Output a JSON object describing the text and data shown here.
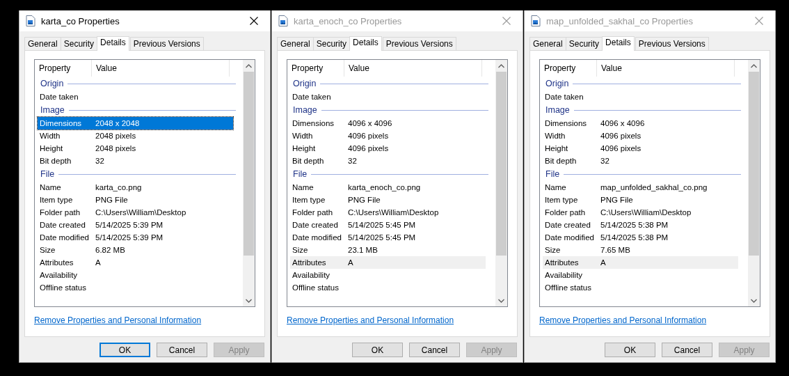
{
  "windows": [
    {
      "title": "karta_co Properties",
      "active": true,
      "tabs": [
        {
          "label": "General",
          "selected": false
        },
        {
          "label": "Security",
          "selected": false
        },
        {
          "label": "Details",
          "selected": true
        },
        {
          "label": "Previous Versions",
          "selected": false
        }
      ],
      "columns": [
        "Property",
        "Value"
      ],
      "groups": [
        {
          "name": "Origin",
          "rows": [
            {
              "property": "Date taken",
              "value": "",
              "selected": false
            }
          ]
        },
        {
          "name": "Image",
          "rows": [
            {
              "property": "Dimensions",
              "value": "2048 x 2048",
              "selected": true
            },
            {
              "property": "Width",
              "value": "2048 pixels",
              "selected": false
            },
            {
              "property": "Height",
              "value": "2048 pixels",
              "selected": false
            },
            {
              "property": "Bit depth",
              "value": "32",
              "selected": false
            }
          ]
        },
        {
          "name": "File",
          "rows": [
            {
              "property": "Name",
              "value": "karta_co.png",
              "selected": false
            },
            {
              "property": "Item type",
              "value": "PNG File",
              "selected": false
            },
            {
              "property": "Folder path",
              "value": "C:\\Users\\William\\Desktop",
              "selected": false
            },
            {
              "property": "Date created",
              "value": "5/14/2025 5:39 PM",
              "selected": false
            },
            {
              "property": "Date modified",
              "value": "5/14/2025 5:39 PM",
              "selected": false
            },
            {
              "property": "Size",
              "value": "6.82 MB",
              "selected": false
            },
            {
              "property": "Attributes",
              "value": "A",
              "selected": false
            },
            {
              "property": "Availability",
              "value": "",
              "selected": false
            },
            {
              "property": "Offline status",
              "value": "",
              "selected": false
            }
          ]
        }
      ],
      "link": "Remove Properties and Personal Information",
      "buttons": [
        {
          "label": "OK",
          "disabled": false
        },
        {
          "label": "Cancel",
          "disabled": false
        },
        {
          "label": "Apply",
          "disabled": true
        }
      ]
    },
    {
      "title": "karta_enoch_co Properties",
      "active": false,
      "tabs": [
        {
          "label": "General",
          "selected": false
        },
        {
          "label": "Security",
          "selected": false
        },
        {
          "label": "Details",
          "selected": true
        },
        {
          "label": "Previous Versions",
          "selected": false
        }
      ],
      "columns": [
        "Property",
        "Value"
      ],
      "groups": [
        {
          "name": "Origin",
          "rows": [
            {
              "property": "Date taken",
              "value": "",
              "selected": false
            }
          ]
        },
        {
          "name": "Image",
          "rows": [
            {
              "property": "Dimensions",
              "value": "4096 x 4096",
              "selected": false
            },
            {
              "property": "Width",
              "value": "4096 pixels",
              "selected": false
            },
            {
              "property": "Height",
              "value": "4096 pixels",
              "selected": false
            },
            {
              "property": "Bit depth",
              "value": "32",
              "selected": false
            }
          ]
        },
        {
          "name": "File",
          "rows": [
            {
              "property": "Name",
              "value": "karta_enoch_co.png",
              "selected": false
            },
            {
              "property": "Item type",
              "value": "PNG File",
              "selected": false
            },
            {
              "property": "Folder path",
              "value": "C:\\Users\\William\\Desktop",
              "selected": false
            },
            {
              "property": "Date created",
              "value": "5/14/2025 5:45 PM",
              "selected": false
            },
            {
              "property": "Date modified",
              "value": "5/14/2025 5:45 PM",
              "selected": false
            },
            {
              "property": "Size",
              "value": "23.1 MB",
              "selected": false
            },
            {
              "property": "Attributes",
              "value": "A",
              "selected": true
            },
            {
              "property": "Availability",
              "value": "",
              "selected": false
            },
            {
              "property": "Offline status",
              "value": "",
              "selected": false
            }
          ]
        }
      ],
      "link": "Remove Properties and Personal Information",
      "buttons": [
        {
          "label": "OK",
          "disabled": false
        },
        {
          "label": "Cancel",
          "disabled": false
        },
        {
          "label": "Apply",
          "disabled": true
        }
      ]
    },
    {
      "title": "map_unfolded_sakhal_co Properties",
      "active": false,
      "tabs": [
        {
          "label": "General",
          "selected": false
        },
        {
          "label": "Security",
          "selected": false
        },
        {
          "label": "Details",
          "selected": true
        },
        {
          "label": "Previous Versions",
          "selected": false
        }
      ],
      "columns": [
        "Property",
        "Value"
      ],
      "groups": [
        {
          "name": "Origin",
          "rows": [
            {
              "property": "Date taken",
              "value": "",
              "selected": false
            }
          ]
        },
        {
          "name": "Image",
          "rows": [
            {
              "property": "Dimensions",
              "value": "4096 x 4096",
              "selected": false
            },
            {
              "property": "Width",
              "value": "4096 pixels",
              "selected": false
            },
            {
              "property": "Height",
              "value": "4096 pixels",
              "selected": false
            },
            {
              "property": "Bit depth",
              "value": "32",
              "selected": false
            }
          ]
        },
        {
          "name": "File",
          "rows": [
            {
              "property": "Name",
              "value": "map_unfolded_sakhal_co.png",
              "selected": false
            },
            {
              "property": "Item type",
              "value": "PNG File",
              "selected": false
            },
            {
              "property": "Folder path",
              "value": "C:\\Users\\William\\Desktop",
              "selected": false
            },
            {
              "property": "Date created",
              "value": "5/14/2025 5:38 PM",
              "selected": false
            },
            {
              "property": "Date modified",
              "value": "5/14/2025 5:38 PM",
              "selected": false
            },
            {
              "property": "Size",
              "value": "7.65 MB",
              "selected": false
            },
            {
              "property": "Attributes",
              "value": "A",
              "selected": true
            },
            {
              "property": "Availability",
              "value": "",
              "selected": false
            },
            {
              "property": "Offline status",
              "value": "",
              "selected": false
            }
          ]
        }
      ],
      "link": "Remove Properties and Personal Information",
      "buttons": [
        {
          "label": "OK",
          "disabled": false
        },
        {
          "label": "Cancel",
          "disabled": false
        },
        {
          "label": "Apply",
          "disabled": true
        }
      ]
    }
  ]
}
